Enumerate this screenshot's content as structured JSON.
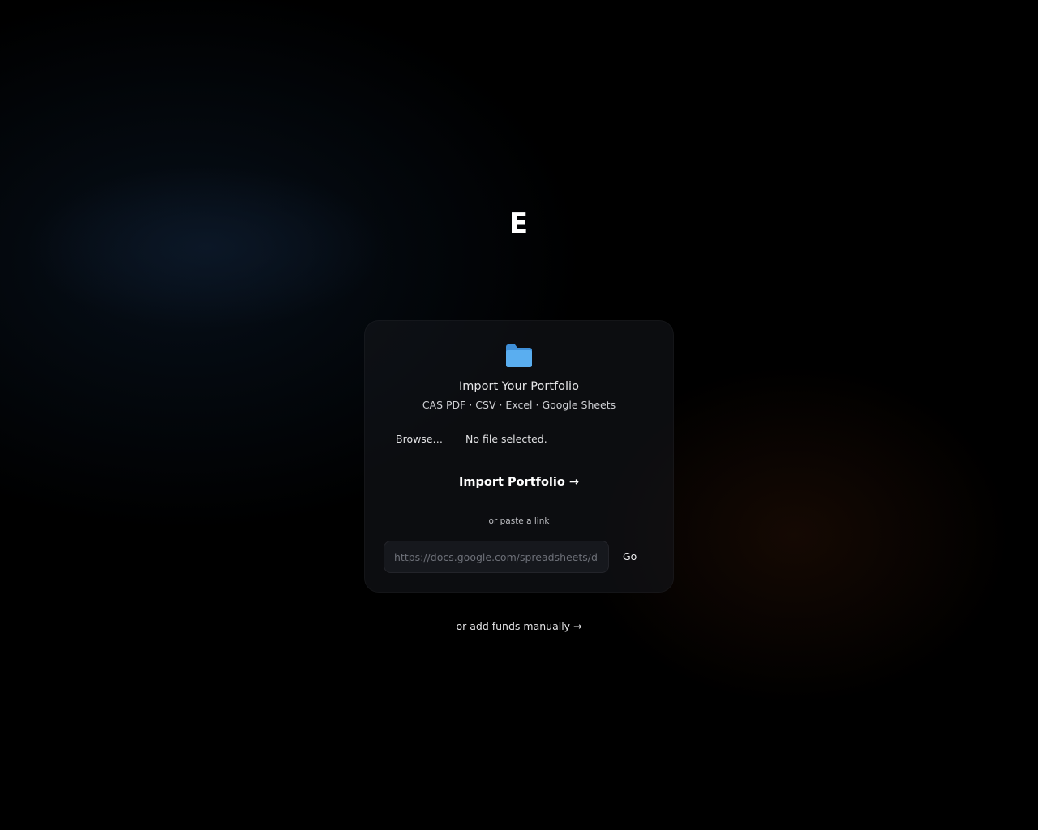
{
  "brand": {
    "logo_text": "E"
  },
  "import_card": {
    "icon": "folder-icon",
    "title": "Import Your Portfolio",
    "subtitle": "CAS PDF · CSV · Excel · Google Sheets",
    "browse_label": "Browse…",
    "file_status": "No file selected.",
    "import_button_label": "Import Portfolio →",
    "paste_label": "or paste a link",
    "link_input": {
      "value": "",
      "placeholder": "https://docs.google.com/spreadsheets/d/..."
    },
    "go_label": "Go"
  },
  "manual_link_label": "or add funds manually →",
  "colors": {
    "background": "#000000",
    "folder_icon": "#4a9ee8",
    "card": "#16181e"
  }
}
